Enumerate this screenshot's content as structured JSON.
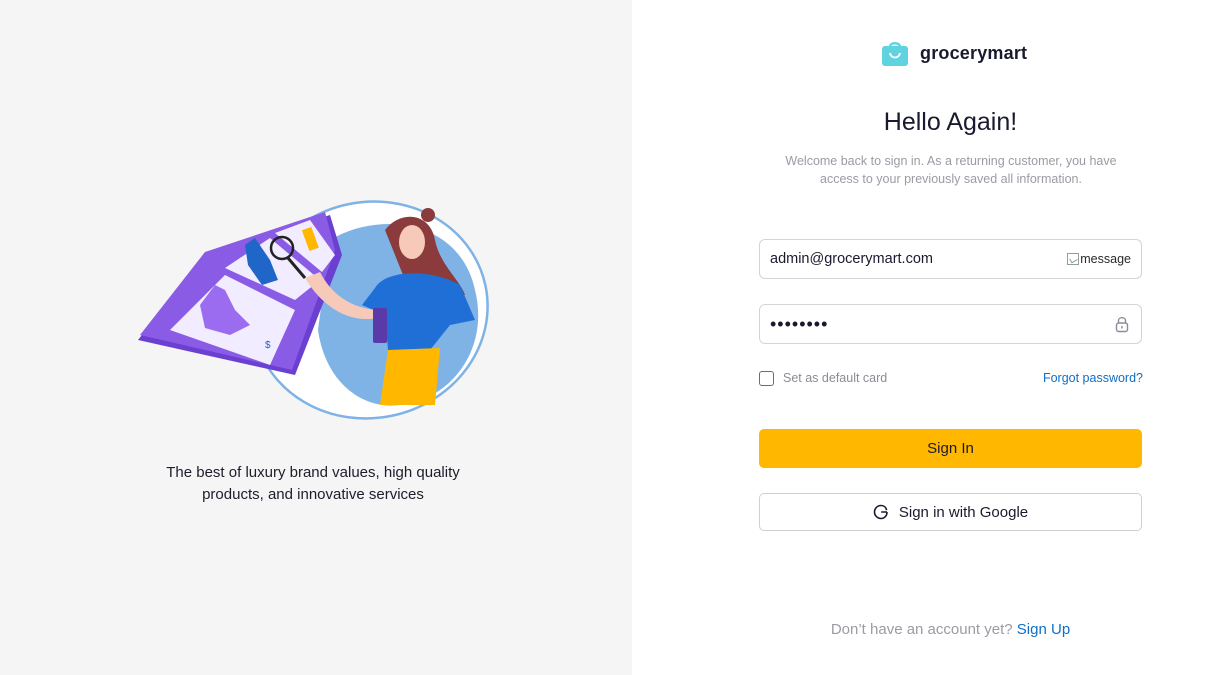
{
  "left_panel": {
    "tagline_line1": "The best of luxury brand values, high quality",
    "tagline_line2": "products, and innovative services"
  },
  "brand": {
    "name": "grocerymart",
    "logo_icon": "shopping-bag-icon",
    "logo_color": "#5fd3e0"
  },
  "form": {
    "title": "Hello Again!",
    "subtitle": "Welcome back to sign in. As a returning customer, you have access to your previously saved all information.",
    "email_value": "admin@grocerymart.com",
    "email_icon_alt": "message",
    "password_value": "12345678",
    "password_icon": "lock-icon",
    "checkbox_label": "Set as default card",
    "checkbox_checked": false,
    "forgot_label": "Forgot password?",
    "signin_label": "Sign In",
    "google_label": "Sign in with Google",
    "google_icon": "google-g-icon"
  },
  "footer": {
    "prompt": "Don’t have an account yet?",
    "signup_label": "Sign Up"
  },
  "colors": {
    "accent": "#ffb700",
    "link": "#0f6fc6",
    "left_bg": "#f5f5f5",
    "illustration_purple": "#7c4ddb",
    "illustration_blue": "#7fb3e6"
  }
}
